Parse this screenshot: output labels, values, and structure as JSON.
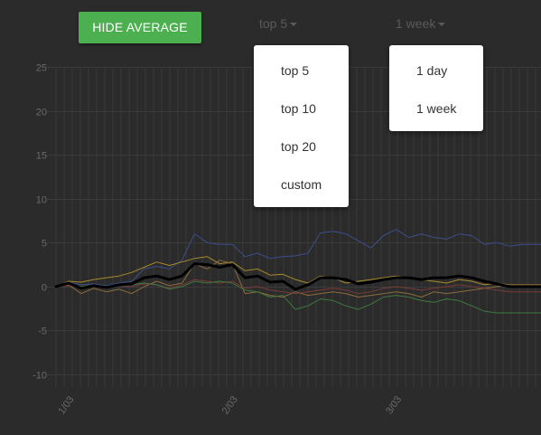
{
  "toolbar": {
    "average_button_label": "HIDE AVERAGE",
    "count_dropdown": {
      "selected": "top 5",
      "options": [
        "top 5",
        "top 10",
        "top 20",
        "custom"
      ]
    },
    "period_dropdown": {
      "selected": "1 week",
      "options": [
        "1 day",
        "1 week"
      ]
    }
  },
  "colors": {
    "background": "#2b2b2b",
    "button": "#4caf50",
    "grid": "#3a3a3a",
    "axis_text": "#6a6a6a"
  },
  "chart_data": {
    "type": "line",
    "ylim": [
      -10,
      25
    ],
    "yticks": [
      25,
      20,
      15,
      10,
      5,
      0,
      -5,
      -10
    ],
    "x": [
      0,
      1,
      2,
      3,
      4,
      5,
      6,
      7,
      8,
      9,
      10,
      11,
      12,
      13,
      14,
      15,
      16,
      17,
      18,
      19,
      20,
      21,
      22,
      23,
      24,
      25,
      26,
      27,
      28,
      29,
      30,
      31,
      32,
      33,
      34,
      35,
      36,
      37,
      38,
      39,
      40,
      41
    ],
    "xlim": [
      0,
      38.5
    ],
    "xtick_labels": [
      {
        "x": 1,
        "label": "1/03"
      },
      {
        "x": 14,
        "label": "2/03"
      },
      {
        "x": 27,
        "label": "3/03"
      }
    ],
    "series": [
      {
        "role": "average",
        "color": "#000000",
        "width": 3,
        "values": [
          0,
          0.4,
          -0.2,
          0.1,
          -0.1,
          0.2,
          0.3,
          1.0,
          1.2,
          0.8,
          1.2,
          2.6,
          2.5,
          2.2,
          2.5,
          1.0,
          1.2,
          0.5,
          0.6,
          -0.3,
          0.2,
          1.0,
          1.0,
          0.8,
          0.3,
          0.5,
          0.8,
          1.0,
          1.0,
          0.8,
          1.0,
          1.0,
          1.2,
          1.0,
          0.6,
          0.3,
          0.0,
          0.0,
          0.0,
          0.0,
          0.0,
          0.0
        ]
      },
      {
        "color": "#3d4e8c",
        "width": 1,
        "values": [
          0,
          0.5,
          0.2,
          0.3,
          0.1,
          0.4,
          0.6,
          2.0,
          2.3,
          2.0,
          3.0,
          6.0,
          5.0,
          4.8,
          4.8,
          3.4,
          3.8,
          3.2,
          3.4,
          3.5,
          3.8,
          6.1,
          6.3,
          6.0,
          5.2,
          4.4,
          5.8,
          6.5,
          5.6,
          6.0,
          5.6,
          5.4,
          6.0,
          5.8,
          4.8,
          5.0,
          4.6,
          4.8,
          4.8,
          4.8,
          4.8,
          4.8
        ]
      },
      {
        "color": "#a68a2a",
        "width": 1,
        "values": [
          0,
          0.6,
          0.5,
          0.8,
          1.0,
          1.2,
          1.6,
          2.2,
          2.8,
          2.4,
          2.8,
          3.2,
          3.4,
          2.6,
          2.8,
          1.8,
          2.0,
          1.3,
          1.4,
          0.8,
          0.4,
          1.2,
          1.0,
          0.4,
          0.6,
          0.8,
          1.0,
          1.2,
          1.0,
          0.8,
          0.6,
          0.4,
          0.8,
          0.6,
          0.2,
          0.4,
          0.2,
          0.2,
          0.2,
          0.2,
          0.2,
          0.2
        ]
      },
      {
        "color": "#8c6c3a",
        "width": 1,
        "values": [
          0,
          0.2,
          -0.8,
          -0.2,
          -0.6,
          -0.3,
          -0.8,
          0.0,
          0.6,
          0.1,
          0.4,
          2.6,
          2.0,
          3.0,
          2.6,
          -0.8,
          -0.6,
          -1.0,
          -1.2,
          -0.6,
          -1.0,
          -0.8,
          -0.6,
          -0.8,
          -1.2,
          -1.0,
          -0.8,
          -0.6,
          -0.8,
          -1.2,
          -0.6,
          -0.8,
          -0.6,
          -0.4,
          -0.2,
          0.0,
          0.2,
          0.2,
          0.2,
          0.2,
          0.2,
          0.2
        ]
      },
      {
        "color": "#7a3a3a",
        "width": 1,
        "values": [
          0,
          0.1,
          0.0,
          0.2,
          -0.1,
          0.1,
          0.0,
          0.3,
          0.2,
          -0.2,
          0.2,
          0.8,
          0.6,
          0.4,
          0.6,
          -0.2,
          0.0,
          -0.4,
          -0.6,
          -0.8,
          -0.6,
          -0.4,
          -0.2,
          -0.4,
          -0.8,
          -0.6,
          -0.2,
          0.0,
          -0.2,
          -0.4,
          -0.2,
          0.0,
          0.2,
          0.0,
          -0.2,
          -0.4,
          -0.6,
          -0.6,
          -0.6,
          -0.6,
          -0.6,
          -0.6
        ]
      },
      {
        "color": "#3f7a3f",
        "width": 1,
        "values": [
          0,
          0.3,
          0.0,
          0.2,
          0.0,
          0.1,
          0.2,
          0.4,
          0.2,
          -0.3,
          0.0,
          0.6,
          0.4,
          0.6,
          0.4,
          -0.4,
          -0.6,
          -1.2,
          -1.0,
          -2.6,
          -2.2,
          -1.4,
          -1.6,
          -2.2,
          -2.6,
          -2.0,
          -1.2,
          -1.0,
          -1.2,
          -1.6,
          -1.8,
          -1.4,
          -1.6,
          -2.2,
          -2.8,
          -3.0,
          -3.0,
          -3.0,
          -3.0,
          -3.0,
          -3.0,
          -3.0
        ]
      }
    ]
  }
}
